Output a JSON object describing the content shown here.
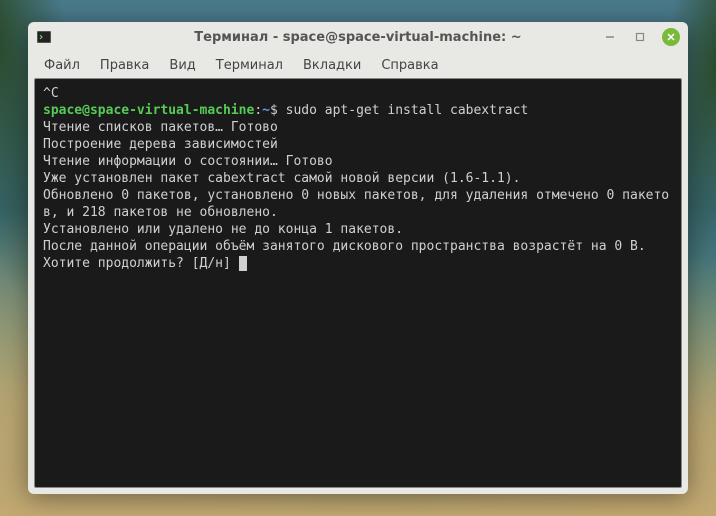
{
  "window": {
    "title": "Терминал - space@space-virtual-machine: ~"
  },
  "menu": {
    "file": "Файл",
    "edit": "Правка",
    "view": "Вид",
    "terminal": "Терминал",
    "tabs": "Вкладки",
    "help": "Справка"
  },
  "terminal": {
    "interrupt": "^C",
    "prompt_user": "space@space-virtual-machine",
    "prompt_sep": ":",
    "prompt_path": "~",
    "prompt_sym": "$ ",
    "command": "sudo apt-get install cabextract",
    "lines": {
      "l1": "Чтение списков пакетов… Готово",
      "l2": "Построение дерева зависимостей",
      "l3": "Чтение информации о состоянии… Готово",
      "l4": "Уже установлен пакет cabextract самой новой версии (1.6-1.1).",
      "l5": "Обновлено 0 пакетов, установлено 0 новых пакетов, для удаления отмечено 0 пакетов, и 218 пакетов не обновлено.",
      "l6": "Установлено или удалено не до конца 1 пакетов.",
      "l7": "После данной операции объём занятого дискового пространства возрастёт на 0 B.",
      "l8": "Хотите продолжить? [Д/н] "
    }
  }
}
